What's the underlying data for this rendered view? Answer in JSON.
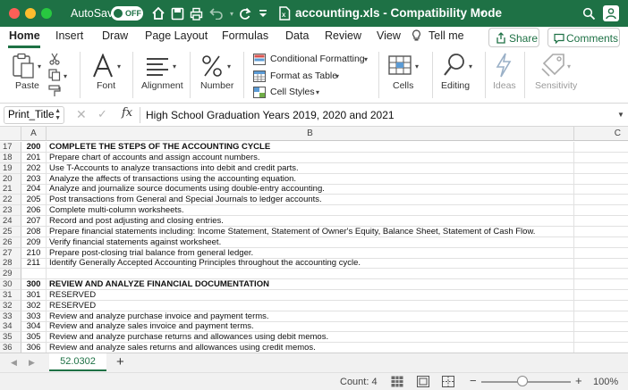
{
  "titlebar": {
    "autosave_label": "AutoSave",
    "autosave_state": "OFF",
    "document_title": "accounting.xls  -  Compatibility Mode",
    "icons": [
      "home-icon",
      "save-icon",
      "print-icon",
      "undo-icon",
      "redo-icon",
      "customize-icon",
      "document-icon",
      "search-icon",
      "share-person-icon"
    ],
    "accent_color": "#1e7145"
  },
  "tabs": {
    "items": [
      "Home",
      "Insert",
      "Draw",
      "Page Layout",
      "Formulas",
      "Data",
      "Review",
      "View"
    ],
    "active": "Home",
    "tell_me": "Tell me",
    "share_label": "Share",
    "comments_label": "Comments"
  },
  "ribbon": {
    "paste": "Paste",
    "font": "Font",
    "alignment": "Alignment",
    "number": "Number",
    "conditional_formatting": "Conditional Formatting",
    "format_as_table": "Format as Table",
    "cell_styles": "Cell Styles",
    "cells": "Cells",
    "editing": "Editing",
    "ideas": "Ideas",
    "sensitivity": "Sensitivity"
  },
  "formula_bar": {
    "name_box": "Print_Title",
    "formula": "High School Graduation Years 2019, 2020 and 2021"
  },
  "grid": {
    "columns": [
      "A",
      "B",
      "C"
    ],
    "rows": [
      {
        "row": "17",
        "a": "200",
        "b": "COMPLETE THE STEPS OF THE ACCOUNTING CYCLE",
        "bold": true
      },
      {
        "row": "18",
        "a": "201",
        "b": "Prepare chart of accounts and assign account numbers.",
        "bold": false
      },
      {
        "row": "19",
        "a": "202",
        "b": "Use T-Accounts to analyze transactions into debit and credit parts.",
        "bold": false
      },
      {
        "row": "20",
        "a": "203",
        "b": "Analyze the affects of transactions using the accounting equation.",
        "bold": false
      },
      {
        "row": "21",
        "a": "204",
        "b": "Analyze and journalize source documents using double-entry accounting.",
        "bold": false
      },
      {
        "row": "22",
        "a": "205",
        "b": "Post transactions from General and Special Journals to ledger accounts.",
        "bold": false
      },
      {
        "row": "23",
        "a": "206",
        "b": "Complete multi-column worksheets.",
        "bold": false
      },
      {
        "row": "24",
        "a": "207",
        "b": "Record and post adjusting and closing entries.",
        "bold": false
      },
      {
        "row": "25",
        "a": "208",
        "b": "Prepare financial statements including: Income Statement, Statement of Owner's Equity, Balance Sheet, Statement of Cash Flow.",
        "bold": false
      },
      {
        "row": "26",
        "a": "209",
        "b": "Verify financial statements against worksheet.",
        "bold": false
      },
      {
        "row": "27",
        "a": "210",
        "b": "Prepare post-closing trial balance from general ledger.",
        "bold": false
      },
      {
        "row": "28",
        "a": "211",
        "b": "Identify Generally Accepted Accounting Principles throughout the accounting cycle.",
        "bold": false
      },
      {
        "row": "29",
        "a": "",
        "b": "",
        "bold": false
      },
      {
        "row": "30",
        "a": "300",
        "b": "REVIEW AND ANALYZE FINANCIAL DOCUMENTATION",
        "bold": true
      },
      {
        "row": "31",
        "a": "301",
        "b": "RESERVED",
        "bold": false
      },
      {
        "row": "32",
        "a": "302",
        "b": "RESERVED",
        "bold": false
      },
      {
        "row": "33",
        "a": "303",
        "b": "Review and analyze purchase invoice and payment terms.",
        "bold": false
      },
      {
        "row": "34",
        "a": "304",
        "b": "Review and analyze sales invoice and payment terms.",
        "bold": false
      },
      {
        "row": "35",
        "a": "305",
        "b": "Review and analyze purchase returns and allowances using debit memos.",
        "bold": false
      },
      {
        "row": "36",
        "a": "306",
        "b": "Review and analyze sales returns and allowances using credit memos.",
        "bold": false
      }
    ]
  },
  "sheets": {
    "active": "52.0302",
    "add_label": "+"
  },
  "status": {
    "count": "Count: 4",
    "zoom_minus": "−",
    "zoom_plus": "+",
    "zoom": "100%",
    "zoom_level_percent": 100
  }
}
